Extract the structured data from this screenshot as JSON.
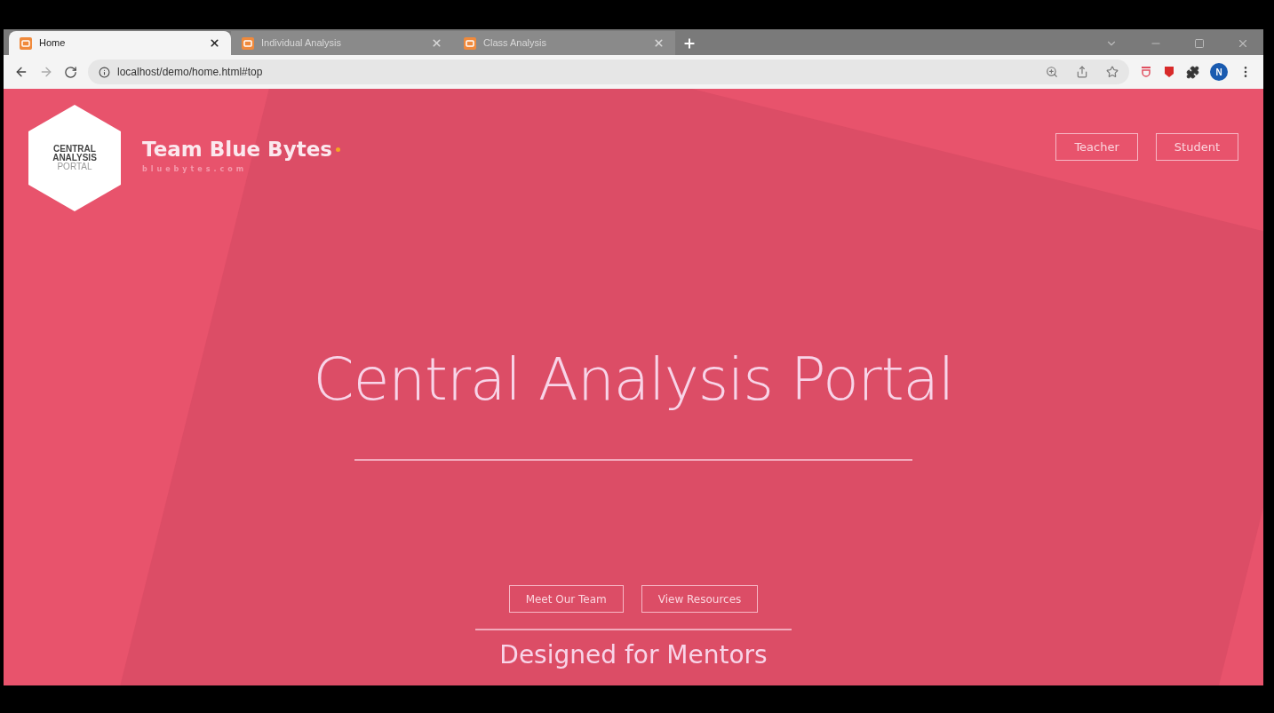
{
  "tabs": [
    {
      "title": "Home",
      "selected": true
    },
    {
      "title": "Individual Analysis",
      "selected": false
    },
    {
      "title": "Class Analysis",
      "selected": false
    }
  ],
  "address_bar": {
    "url": "localhost/demo/home.html#top"
  },
  "profile": {
    "initial": "N"
  },
  "logo": {
    "lines": [
      "CENTRAL",
      "ANALYSIS",
      "PORTAL"
    ]
  },
  "brand": {
    "name": "Team Blue Bytes",
    "tagline": "bluebytes.com"
  },
  "nav_buttons": [
    "Teacher",
    "Student"
  ],
  "hero": {
    "title": "Central Analysis Portal"
  },
  "cta_buttons": [
    "Meet Our Team",
    "View Resources"
  ],
  "section_heading": "Designed for Mentors"
}
